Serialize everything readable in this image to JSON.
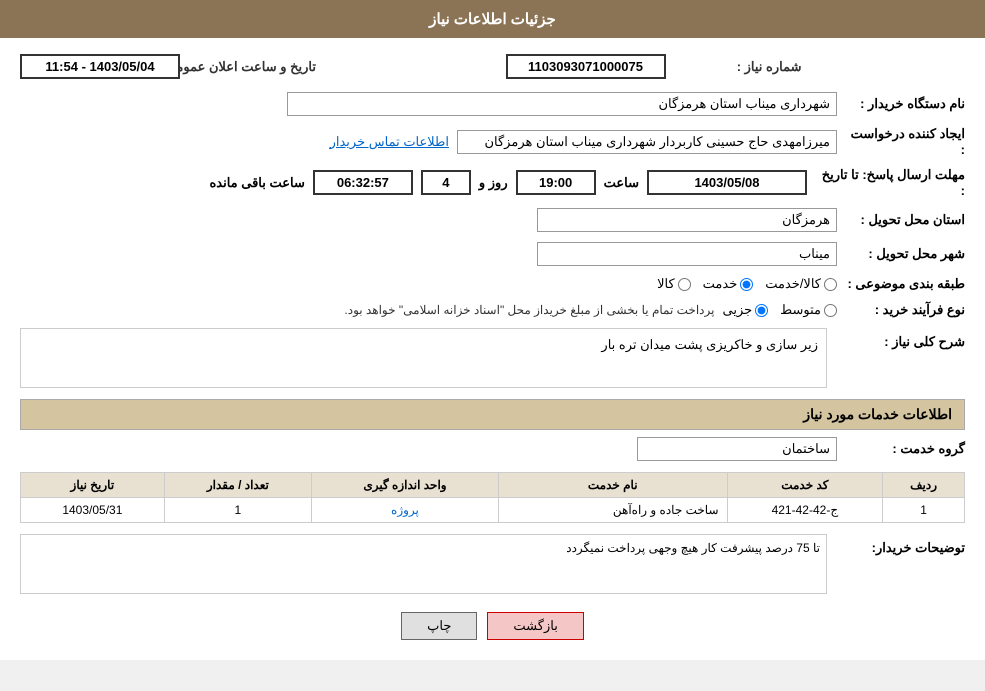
{
  "header": {
    "title": "جزئیات اطلاعات نیاز"
  },
  "fields": {
    "shomare_niaz_label": "شماره نیاز :",
    "shomare_niaz_value": "1103093071000075",
    "nam_dastgah_label": "نام دستگاه خریدار :",
    "nam_dastgah_value": "شهرداری میناب استان هرمزگان",
    "ijad_konande_label": "ایجاد کننده درخواست :",
    "ijad_konande_value": "میرزامهدی حاج حسینی کاربردار شهرداری میناب استان هرمزگان",
    "ettelaat_tamas_label": "اطلاعات تماس خریدار",
    "mohlet_label": "مهلت ارسال پاسخ: تا تاریخ :",
    "tarikh_value": "1403/05/08",
    "saat_label": "ساعت",
    "saat_value": "19:00",
    "rooz_label": "روز و",
    "rooz_value": "4",
    "saat_mande_label": "ساعت باقی مانده",
    "saat_mande_value": "06:32:57",
    "tarikh_elam_label": "تاریخ و ساعت اعلان عمومی :",
    "tarikh_elam_value": "1403/05/04 - 11:54",
    "ostan_tahvil_label": "استان محل تحویل :",
    "ostan_tahvil_value": "هرمزگان",
    "shahr_tahvil_label": "شهر محل تحویل :",
    "shahr_tahvil_value": "میناب",
    "tabaqe_label": "طبقه بندی موضوعی :",
    "radio_kala": "کالا",
    "radio_khedmat": "خدمت",
    "radio_kala_khedmat": "کالا/خدمت",
    "radio_selected": "khedmat",
    "type_label": "نوع فرآیند خرید :",
    "radio_jozyi": "جزیی",
    "radio_mottawaset": "متوسط",
    "type_notice": "پرداخت تمام یا بخشی از مبلغ خریداز محل \"اسناد خزانه اسلامی\" خواهد بود.",
    "sharh_label": "شرح کلی نیاز :",
    "sharh_value": "زیر سازی و خاکریزی پشت میدان تره بار",
    "services_section": "اطلاعات خدمات مورد نیاز",
    "group_label": "گروه خدمت :",
    "group_value": "ساختمان",
    "table_headers": {
      "radif": "ردیف",
      "code": "کد خدمت",
      "name": "نام خدمت",
      "unit": "واحد اندازه گیری",
      "count": "تعداد / مقدار",
      "date": "تاریخ نیاز"
    },
    "table_rows": [
      {
        "radif": "1",
        "code": "ج-42-42-421",
        "name": "ساخت جاده و راه‌آهن",
        "unit": "پروژه",
        "count": "1",
        "date": "1403/05/31"
      }
    ],
    "tozihat_label": "توضیحات خریدار:",
    "tozihat_value": "تا 75 درصد پیشرفت کار هیچ وجهی پرداخت نمیگردد",
    "btn_print": "چاپ",
    "btn_back": "بازگشت"
  }
}
